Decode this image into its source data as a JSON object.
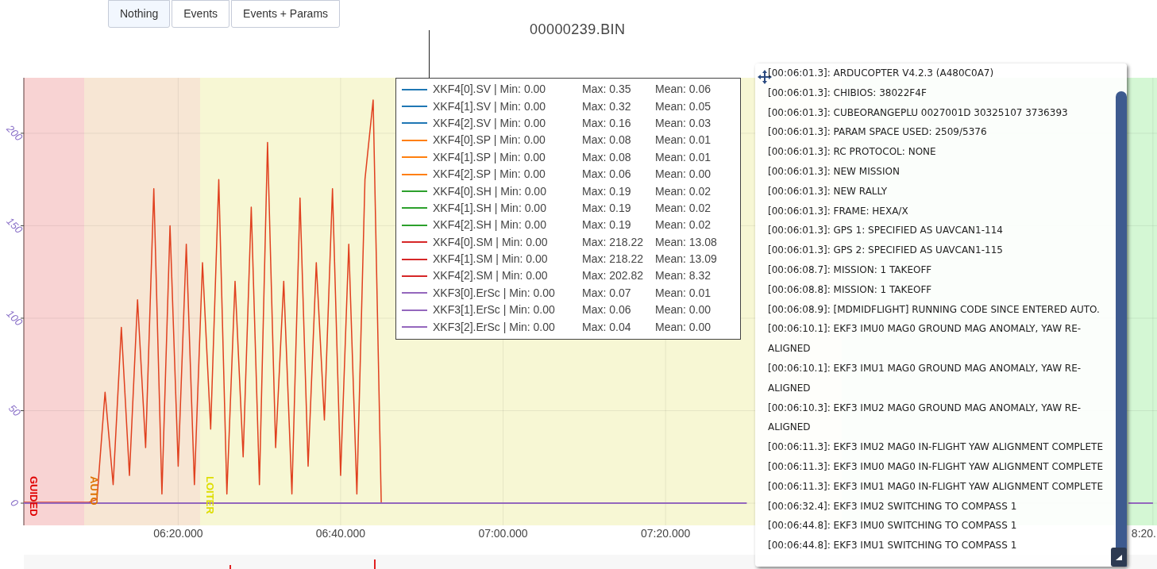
{
  "buttons": [
    {
      "label": "Nothing",
      "selected": true
    },
    {
      "label": "Events",
      "selected": false
    },
    {
      "label": "Events + Params",
      "selected": false
    }
  ],
  "chart": {
    "title": "00000239.BIN",
    "chart_data": {
      "type": "line",
      "categories": [
        null,
        null,
        null,
        null,
        null,
        null,
        null,
        null,
        null,
        null,
        null,
        null,
        null,
        null,
        null,
        null,
        null,
        null,
        null,
        "06:20.000",
        null,
        null,
        null,
        null,
        null,
        null,
        null,
        null,
        null,
        null,
        null,
        null,
        null,
        null,
        null,
        null,
        null,
        null,
        null,
        "06:40.000",
        null,
        null,
        null,
        null,
        null,
        null,
        null,
        null,
        null,
        null,
        null,
        null,
        null,
        null,
        null,
        null,
        null,
        null,
        null,
        "07:00.000",
        null,
        null,
        null,
        null,
        null,
        null,
        null,
        null,
        null,
        null,
        null,
        null,
        null,
        null,
        null,
        null,
        null,
        null,
        null,
        "07:20.000",
        null,
        null,
        null,
        null,
        null,
        null,
        null,
        null,
        null,
        null,
        null,
        null,
        null,
        null,
        null,
        null,
        null,
        null,
        null,
        null,
        null,
        null,
        null,
        null,
        null,
        null,
        null,
        null,
        null,
        null,
        null,
        null,
        null,
        null,
        null,
        null,
        null,
        null,
        null,
        null,
        null,
        null,
        null,
        null,
        null,
        null,
        null,
        null,
        null,
        null,
        null,
        null,
        null,
        null,
        null,
        null,
        null,
        null,
        null,
        "8:20."
      ],
      "series": [
        {
          "color": "#e0401f",
          "values": [
            0.5,
            0.5,
            0.5,
            0.5,
            0.5,
            0.5,
            0.5,
            0.5,
            0.5,
            2,
            60,
            10,
            95,
            15,
            110,
            30,
            170,
            5,
            150,
            20,
            140,
            10,
            130,
            40,
            175,
            5,
            120,
            25,
            160,
            10,
            195,
            30,
            120,
            5,
            165,
            20,
            130,
            45,
            170,
            15,
            140,
            5,
            175,
            218,
            0,
            null,
            null,
            null,
            null,
            null,
            null,
            null,
            null,
            null,
            null,
            null,
            null,
            null,
            null,
            null,
            null,
            null,
            null,
            null,
            null,
            null,
            null,
            null,
            null,
            null,
            null,
            null,
            null,
            null,
            null,
            null,
            null,
            null,
            null,
            null,
            null,
            null,
            null,
            null,
            null,
            null,
            null,
            null,
            null,
            null,
            null,
            null,
            null,
            null,
            null,
            null,
            null,
            null,
            null,
            null,
            null,
            null,
            null,
            null,
            null,
            null,
            null,
            null,
            null,
            null,
            null,
            null,
            null,
            null,
            null,
            null,
            null,
            null,
            null,
            null,
            null,
            null,
            null,
            null,
            null,
            null,
            null,
            null,
            null,
            null,
            null,
            null,
            null,
            null,
            null,
            null,
            null,
            null,
            null,
            null
          ]
        },
        {
          "color": "#9467bd",
          "values": [
            0,
            0,
            0,
            0,
            0,
            0,
            0,
            0,
            0,
            0,
            0,
            0,
            0,
            0,
            0,
            0,
            0,
            0,
            0,
            0,
            0,
            0,
            0,
            0,
            0,
            0,
            0,
            0,
            0,
            0,
            0,
            0,
            0,
            0,
            0,
            0,
            0,
            0,
            0,
            0,
            0,
            0,
            0,
            0,
            0,
            0,
            0,
            0,
            0,
            0,
            0,
            0,
            0,
            0,
            0,
            0,
            0,
            0,
            0,
            0,
            0,
            0,
            0,
            0,
            0,
            0,
            0,
            0,
            0,
            0,
            0,
            0,
            0,
            0,
            0,
            0,
            0,
            0,
            0,
            0,
            0,
            0,
            0,
            0,
            0,
            0,
            0,
            0,
            0,
            0,
            null,
            null,
            null,
            null,
            null,
            null,
            null,
            null,
            null,
            null,
            null,
            null,
            null,
            null,
            null,
            null,
            null,
            null,
            null,
            null,
            null,
            null,
            null,
            null,
            null,
            null,
            null,
            null,
            null,
            null,
            null,
            null,
            null,
            null,
            null,
            null,
            null,
            null,
            null,
            null,
            null,
            null,
            null,
            null,
            null,
            null,
            0,
            0,
            0,
            0
          ]
        }
      ],
      "ylim": [
        -12,
        230
      ],
      "grid": true,
      "yticks": [
        0,
        50,
        100,
        150,
        200
      ]
    },
    "modes": [
      {
        "label": "GUIDED",
        "color": "#f8d3d3"
      },
      {
        "label": "AUTO",
        "color": "#f7e6d4"
      },
      {
        "label": "LOITER",
        "color": "#f7f7d4"
      },
      {
        "color": "#d4f7d4"
      }
    ],
    "legend": [
      {
        "label": "XKF4[0].SV | Min: 0.00",
        "max": "Max: 0.35",
        "mean": "Mean: 0.06",
        "color": "#1f77b4"
      },
      {
        "label": "XKF4[1].SV | Min: 0.00",
        "max": "Max: 0.32",
        "mean": "Mean: 0.05",
        "color": "#1f77b4"
      },
      {
        "label": "XKF4[2].SV | Min: 0.00",
        "max": "Max: 0.16",
        "mean": "Mean: 0.03",
        "color": "#1f77b4"
      },
      {
        "label": "XKF4[0].SP | Min: 0.00",
        "max": "Max: 0.08",
        "mean": "Mean: 0.01",
        "color": "#ff7f0e"
      },
      {
        "label": "XKF4[1].SP | Min: 0.00",
        "max": "Max: 0.08",
        "mean": "Mean: 0.01",
        "color": "#ff7f0e"
      },
      {
        "label": "XKF4[2].SP | Min: 0.00",
        "max": "Max: 0.06",
        "mean": "Mean: 0.00",
        "color": "#ff7f0e"
      },
      {
        "label": "XKF4[0].SH | Min: 0.00",
        "max": "Max: 0.19",
        "mean": "Mean: 0.02",
        "color": "#2ca02c"
      },
      {
        "label": "XKF4[1].SH | Min: 0.00",
        "max": "Max: 0.19",
        "mean": "Mean: 0.02",
        "color": "#2ca02c"
      },
      {
        "label": "XKF4[2].SH | Min: 0.00",
        "max": "Max: 0.19",
        "mean": "Mean: 0.02",
        "color": "#2ca02c"
      },
      {
        "label": "XKF4[0].SM | Min: 0.00",
        "max": "Max: 218.22",
        "mean": "Mean: 13.08",
        "color": "#d62728"
      },
      {
        "label": "XKF4[1].SM | Min: 0.00",
        "max": "Max: 218.22",
        "mean": "Mean: 13.09",
        "color": "#d62728"
      },
      {
        "label": "XKF4[2].SM | Min: 0.00",
        "max": "Max: 202.82",
        "mean": "Mean: 8.32",
        "color": "#d62728"
      },
      {
        "label": "XKF3[0].ErSc | Min: 0.00",
        "max": "Max: 0.07",
        "mean": "Mean: 0.01",
        "color": "#9467bd"
      },
      {
        "label": "XKF3[1].ErSc | Min: 0.00",
        "max": "Max: 0.06",
        "mean": "Mean: 0.00",
        "color": "#9467bd"
      },
      {
        "label": "XKF3[2].ErSc | Min: 0.00",
        "max": "Max: 0.04",
        "mean": "Mean: 0.00",
        "color": "#9467bd"
      }
    ]
  },
  "messages": [
    "[00:06:01.3]: ARDUCOPTER V4.2.3 (A480C0A7)",
    "[00:06:01.3]: CHIBIOS: 38022F4F",
    "[00:06:01.3]: CUBEORANGEPLU 0027001D 30325107 3736393",
    "[00:06:01.3]: PARAM SPACE USED: 2509/5376",
    "[00:06:01.3]: RC PROTOCOL: NONE",
    "[00:06:01.3]: NEW MISSION",
    "[00:06:01.3]: NEW RALLY",
    "[00:06:01.3]: FRAME: HEXA/X",
    "[00:06:01.3]: GPS 1: SPECIFIED AS UAVCAN1-114",
    "[00:06:01.3]: GPS 2: SPECIFIED AS UAVCAN1-115",
    "[00:06:08.7]: MISSION: 1 TAKEOFF",
    "[00:06:08.8]: MISSION: 1 TAKEOFF",
    "[00:06:08.9]: [MDMIDFLIGHT] RUNNING CODE SINCE ENTERED AUTO.",
    "[00:06:10.1]: EKF3 IMU0 MAG0 GROUND MAG ANOMALY, YAW RE-ALIGNED",
    "[00:06:10.1]: EKF3 IMU1 MAG0 GROUND MAG ANOMALY, YAW RE-ALIGNED",
    "[00:06:10.3]: EKF3 IMU2 MAG0 GROUND MAG ANOMALY, YAW RE-ALIGNED",
    "[00:06:11.3]: EKF3 IMU2 MAG0 IN-FLIGHT YAW ALIGNMENT COMPLETE",
    "[00:06:11.3]: EKF3 IMU0 MAG0 IN-FLIGHT YAW ALIGNMENT COMPLETE",
    "[00:06:11.3]: EKF3 IMU1 MAG0 IN-FLIGHT YAW ALIGNMENT COMPLETE",
    "[00:06:32.4]: EKF3 IMU2 SWITCHING TO COMPASS 1",
    "[00:06:44.8]: EKF3 IMU0 SWITCHING TO COMPASS 1",
    "[00:06:44.8]: EKF3 IMU1 SWITCHING TO COMPASS 1"
  ]
}
